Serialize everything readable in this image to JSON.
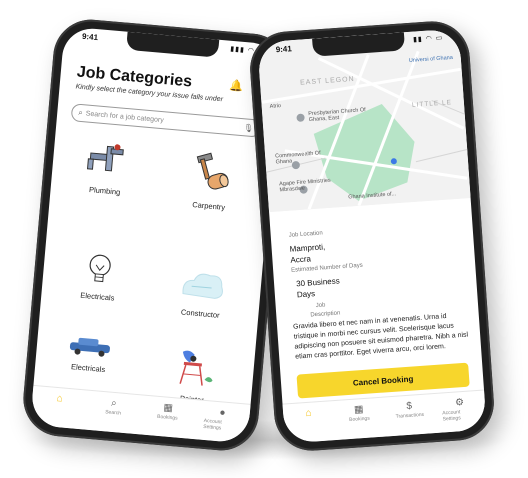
{
  "left_phone": {
    "status_time": "9:41",
    "status_icons": "▮▮▮ ◠ ▭",
    "title": "Job Categories",
    "subtitle": "Kindly select the category your issue falls under",
    "header_icons": {
      "bell": "🔔",
      "gear": "⚙"
    },
    "search": {
      "placeholder": "Search for a job category"
    },
    "categories": [
      {
        "label": "Plumbing"
      },
      {
        "label": "Carpentry"
      },
      {
        "label": "Electricals"
      },
      {
        "label": "Constructor"
      },
      {
        "label": "Electricals"
      },
      {
        "label": "Painter"
      }
    ],
    "tabs": [
      {
        "label": "",
        "icon": "⌂"
      },
      {
        "label": "Search",
        "icon": "⌕"
      },
      {
        "label": "Bookings",
        "icon": "▦"
      },
      {
        "label": "Account Settings",
        "icon": "●"
      }
    ]
  },
  "right_phone": {
    "status_time": "9:41",
    "status_icons": "▮▮ ◠ ▭",
    "map_labels": {
      "university": "Universi of Ghana",
      "east_legon": "EAST LEGON",
      "church": "Presbyterian Church Of Ghana, East",
      "little_legon": "LITTLE LE",
      "commonwealth": "Commonwealth Of Ghana",
      "ministries": "Agape Fire Ministries Mbrasdwe",
      "ghana_institute": "Ghana Institute of...",
      "atrio": "Atrio"
    },
    "job_location_label": "Job Location",
    "job_location_lines": [
      "Mamproti,",
      "Accra"
    ],
    "days_label": "Estimated Number of Days",
    "days_lines": [
      "30 Business",
      "Days"
    ],
    "job_label": "Job",
    "description_label": "Description",
    "description_text": "Gravida libero et nec nam in at venenatis. Urna id tristique in morbi nec cursus velit. Scelerisque lacus adipiscing non posuere sit euismod pharetra. Nibh a nisl etiam cras porttitor. Eget viverra arcu, orci lorem.",
    "cancel_label": "Cancel Booking",
    "tabs": [
      {
        "label": "",
        "icon": "⌂"
      },
      {
        "label": "Bookings",
        "icon": "▦"
      },
      {
        "label": "Transactions",
        "icon": "$"
      },
      {
        "label": "Account Settings",
        "icon": "⚙"
      }
    ]
  },
  "colors": {
    "accent": "#f7d62c",
    "map_green": "#b7e4c7",
    "phone_frame": "#1f1f1f"
  }
}
